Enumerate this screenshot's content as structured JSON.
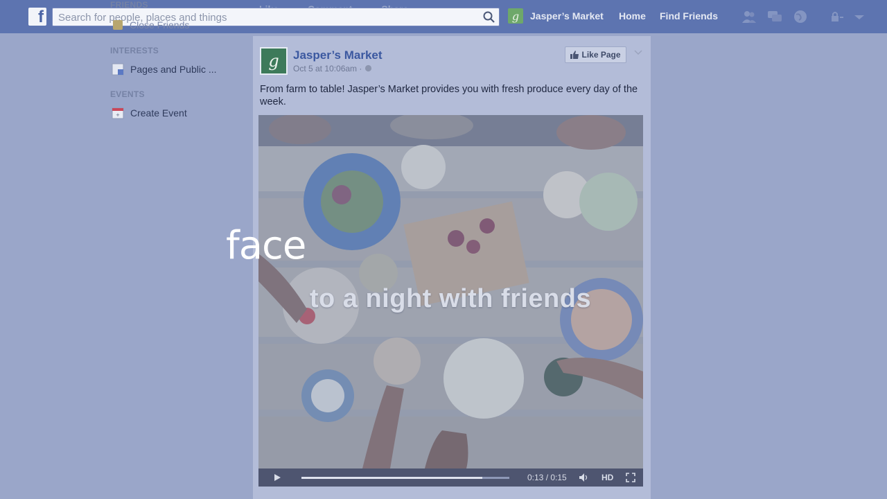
{
  "topbar": {
    "search_placeholder": "Search for people, places and things",
    "page_link": "Jasper’s Market",
    "home": "Home",
    "find_friends": "Find Friends",
    "ghost_like": "Like",
    "ghost_comment": "Comment",
    "ghost_share": "Share"
  },
  "sidebar": {
    "friends_heading": "FRIENDS",
    "close_friends": "Close Friends",
    "interests_heading": "INTERESTS",
    "pages_item": "Pages and Public ...",
    "events_heading": "EVENTS",
    "create_event": "Create Event"
  },
  "post": {
    "page_name": "Jasper’s Market",
    "time": "Oct 5 at 10:06am · ",
    "like_page": "Like Page",
    "text": "From farm to table! Jasper’s Market provides you with fresh produce every day of the week."
  },
  "video": {
    "caption": "to a night with friends",
    "timecode": "0:13 / 0:15",
    "hd": "HD",
    "progress": 0.87
  },
  "overlay": {
    "word": "face"
  },
  "colors": {
    "brand": "#5d74b0",
    "link": "#3b58a0"
  }
}
